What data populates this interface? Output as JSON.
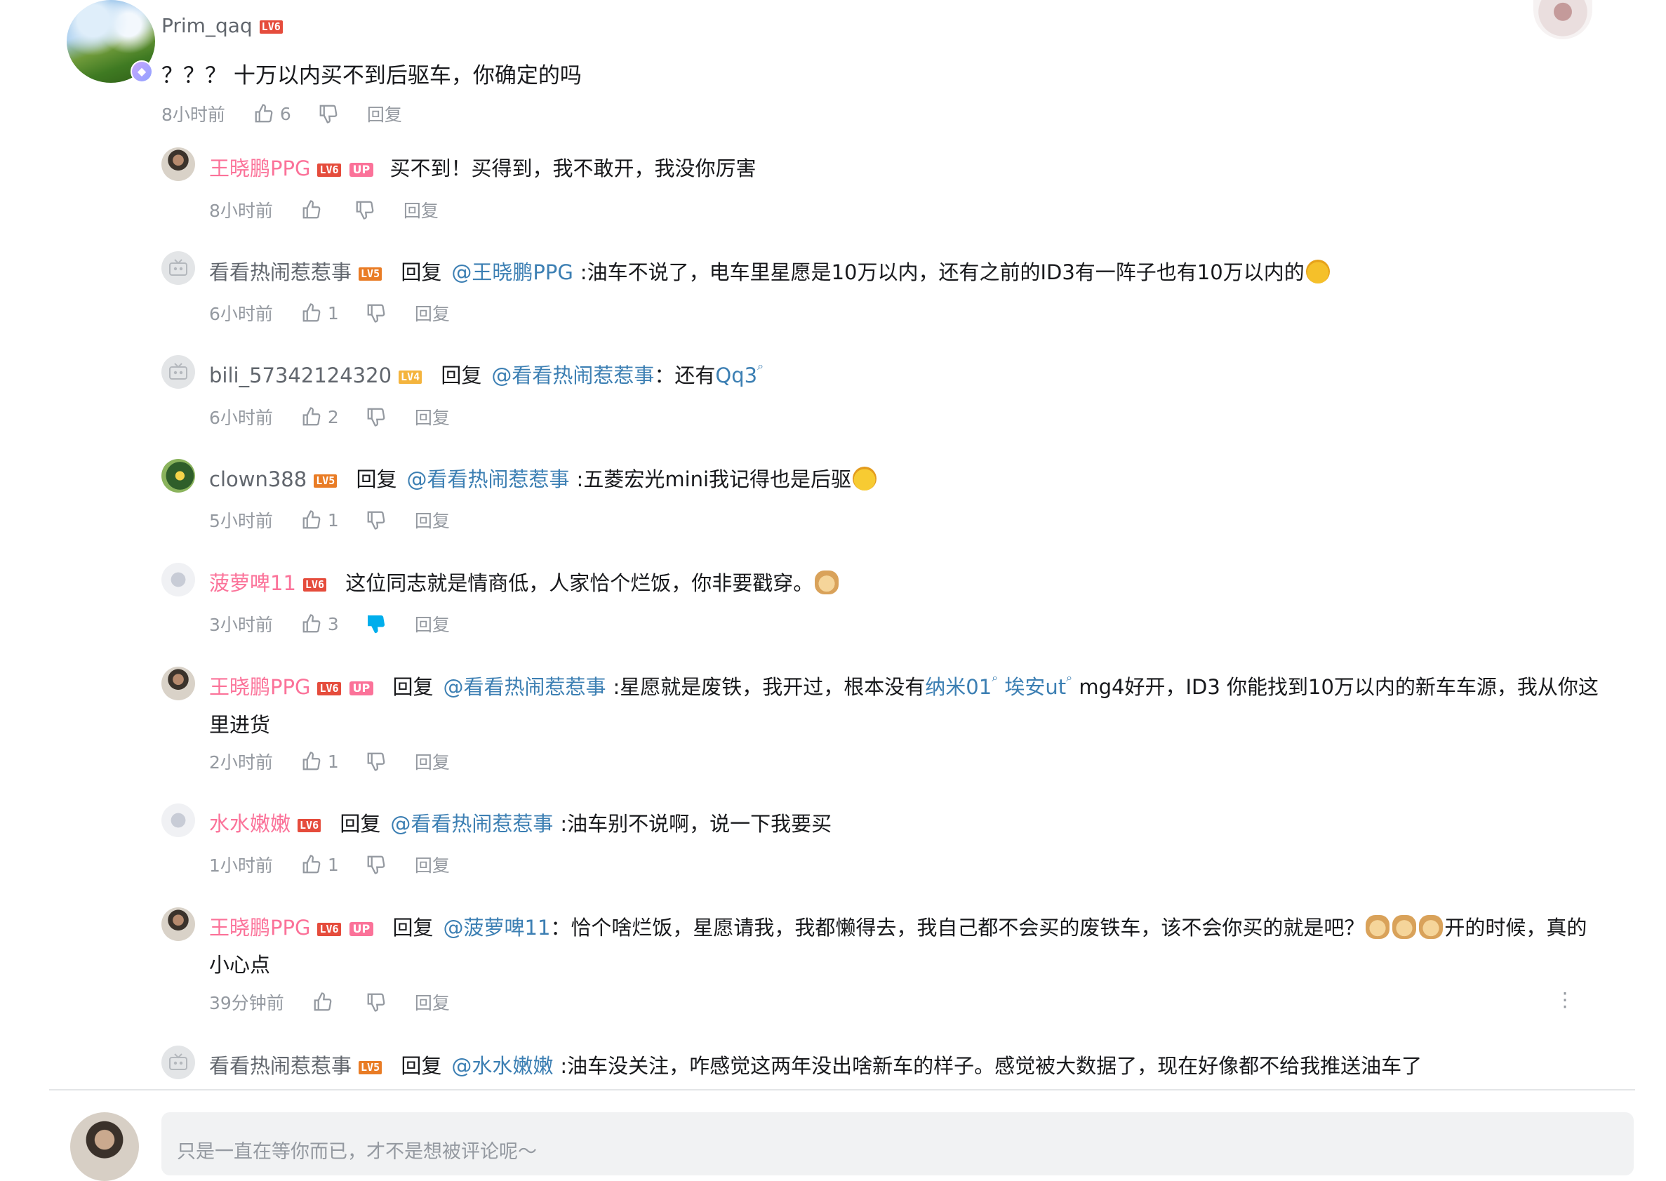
{
  "main_comment": {
    "username": "Prim_qaq",
    "level": "LV6",
    "text": "？？？ 十万以内买不到后驱车，你确定的吗",
    "time": "8小时前",
    "likes": "6",
    "reply_label": "回复"
  },
  "replies": [
    {
      "username": "王晓鹏PPG",
      "level": "LV6",
      "is_up": true,
      "up_label": "UP",
      "reply_word": "",
      "at": "",
      "line1": "买不到！买得到，我不敢开，我没你厉害",
      "line2": "",
      "time": "8小时前",
      "likes": "",
      "reply_label": "回复"
    },
    {
      "username": "看看热闹惹惹事",
      "level": "LV5",
      "is_up": false,
      "reply_word": "回复",
      "at": "@王晓鹏PPG",
      "line1": ":油车不说了，电车里星愿是10万以内，还有之前的ID3有一阵子也有10万以内的",
      "line2": "",
      "time": "6小时前",
      "likes": "1",
      "reply_label": "回复"
    },
    {
      "username": "bili_57342124320",
      "level": "LV4",
      "is_up": false,
      "reply_word": "回复",
      "at": "@看看热闹惹惹事",
      "line1_pre": "：还有",
      "line1_link": "Qq3",
      "time": "6小时前",
      "likes": "2",
      "reply_label": "回复"
    },
    {
      "username": "clown388",
      "level": "LV5",
      "is_up": false,
      "reply_word": "回复",
      "at": "@看看热闹惹惹事",
      "line1": ":五菱宏光mini我记得也是后驱",
      "line2": "",
      "time": "5小时前",
      "likes": "1",
      "reply_label": "回复"
    },
    {
      "username": "菠萝啤11",
      "level": "LV6",
      "is_up": false,
      "reply_word": "",
      "at": "",
      "line1": "这位同志就是情商低，人家恰个烂饭，你非要戳穿。",
      "line2": "",
      "time": "3小时前",
      "likes": "3",
      "reply_label": "回复"
    },
    {
      "username": "王晓鹏PPG",
      "level": "LV6",
      "is_up": true,
      "up_label": "UP",
      "reply_word": "回复",
      "at": "@看看热闹惹惹事",
      "line1_pre": ":星愿就是废铁，我开过，根本没有",
      "link_a": "纳米01",
      "link_b": "埃安ut",
      "line1_post": " mg4好开，ID3 你能找到10万以内的新车车源，我从你这",
      "line2": "里进货",
      "time": "2小时前",
      "likes": "1",
      "reply_label": "回复"
    },
    {
      "username": "水水嫩嫩",
      "level": "LV6",
      "is_up": false,
      "reply_word": "回复",
      "at": "@看看热闹惹惹事",
      "line1": ":油车别不说啊，说一下我要买",
      "line2": "",
      "time": "1小时前",
      "likes": "1",
      "reply_label": "回复"
    },
    {
      "username": "王晓鹏PPG",
      "level": "LV6",
      "is_up": true,
      "up_label": "UP",
      "reply_word": "回复",
      "at": "@菠萝啤11",
      "line1_pre": "：恰个啥烂饭，星愿请我，我都懒得去，我自己都不会买的废铁车，该不会你买的就是吧？",
      "line1_post": "开的时候，真的",
      "line2": "小心点",
      "time": "39分钟前",
      "likes": "",
      "reply_label": "回复"
    },
    {
      "username": "看看热闹惹惹事",
      "level": "LV5",
      "is_up": false,
      "reply_word": "回复",
      "at": "@水水嫩嫩",
      "line1": ":油车没关注，咋感觉这两年没出啥新车的样子。感觉被大数据了，现在好像都不给我推送油车了",
      "line2": ""
    }
  ],
  "comment_input": {
    "placeholder": "只是一直在等你而已，才不是想被评论呢～"
  },
  "colors": {
    "link": "#3c7fb3",
    "up_name": "#fb7299",
    "meta": "#9499a0",
    "disliked": "#00aeec"
  }
}
